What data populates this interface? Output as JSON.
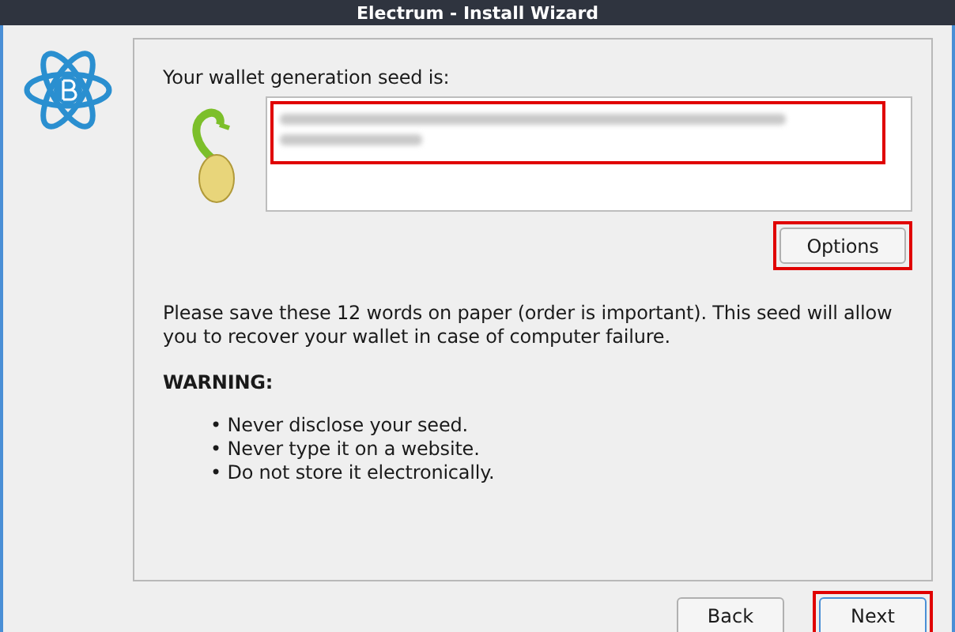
{
  "window": {
    "title": "Electrum  -  Install Wizard"
  },
  "seed": {
    "label": "Your wallet generation seed is:",
    "value_blurred": true,
    "highlighted": true
  },
  "options_button": {
    "label": "Options",
    "highlighted": true
  },
  "message": "Please save these 12 words on paper (order is important). This seed will allow you to recover your wallet in case of computer failure.",
  "warning": {
    "title": "WARNING:",
    "items": [
      "• Never disclose your seed.",
      "• Never type it on a website.",
      "• Do not store it electronically."
    ]
  },
  "buttons": [
    {
      "label": "Back",
      "highlighted": false
    },
    {
      "label": "Next",
      "highlighted": true
    }
  ]
}
